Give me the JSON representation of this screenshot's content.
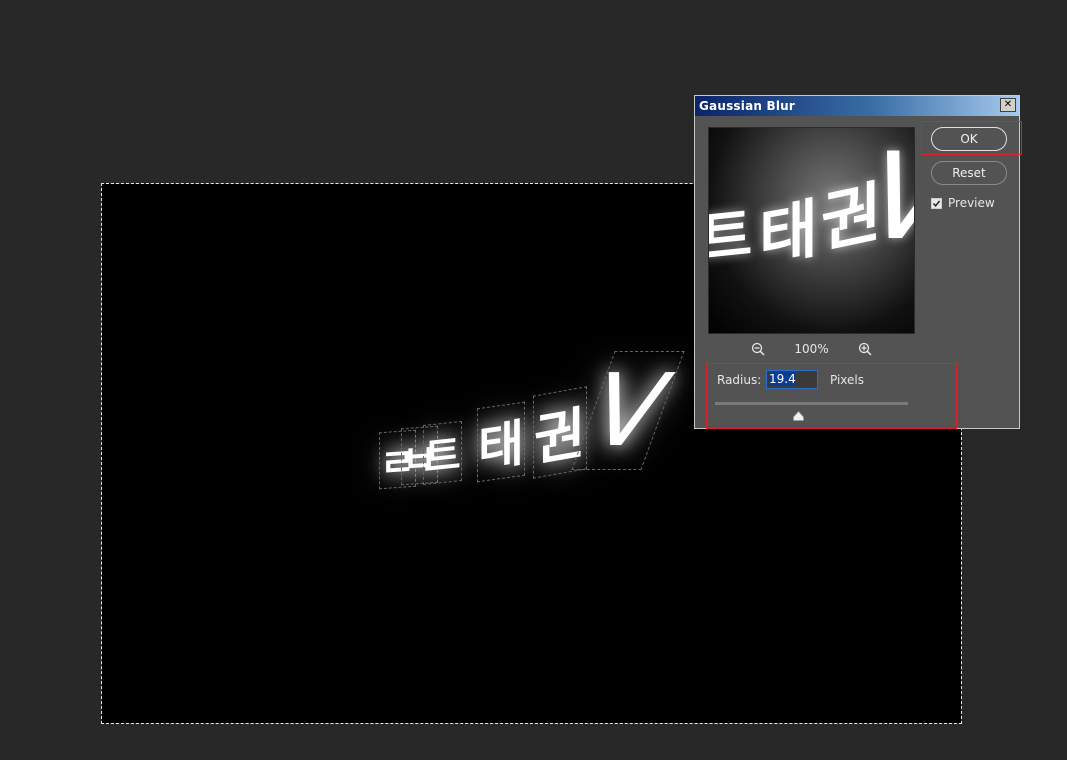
{
  "canvas": {
    "text_fragments": [
      "ㄹ",
      "ㅂ",
      "ㅡ",
      "트",
      "태",
      "권",
      "V"
    ]
  },
  "dialog": {
    "title": "Gaussian Blur",
    "close_label": "✕",
    "zoom": {
      "level": "100%",
      "zoom_out_icon": "zoom-out-icon",
      "zoom_in_icon": "zoom-in-icon"
    },
    "buttons": {
      "ok": "OK",
      "reset": "Reset"
    },
    "preview_checkbox": {
      "label": "Preview",
      "checked": true
    },
    "radius": {
      "label": "Radius:",
      "value": "19.4",
      "units": "Pixels",
      "slider_fraction": 0.43
    },
    "preview_image": {
      "text_fragments": [
        "트",
        "태",
        "권",
        "V"
      ]
    },
    "colors": {
      "title_bar_start": "#0a246a",
      "title_bar_end": "#a6caf0",
      "highlight": "#e0202a",
      "dialog_bg": "#535353"
    }
  }
}
